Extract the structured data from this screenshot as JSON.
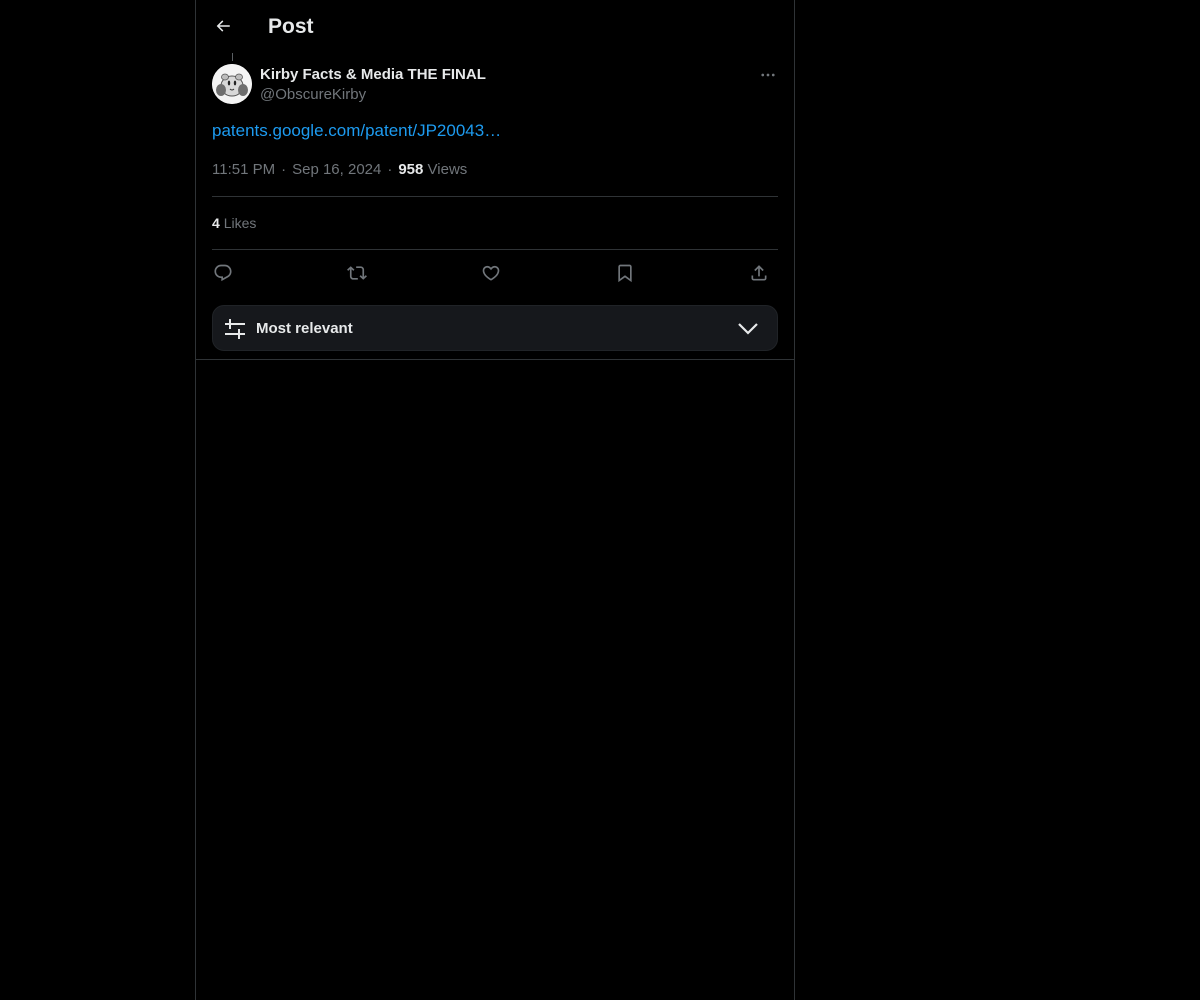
{
  "header": {
    "title": "Post"
  },
  "post": {
    "author": {
      "display_name": "Kirby Facts & Media THE FINAL",
      "handle": "@ObscureKirby"
    },
    "link_text": "patents.google.com/patent/JP20043…",
    "time": "11:51 PM",
    "separator": "·",
    "date": "Sep 16, 2024",
    "views_count": "958",
    "views_label": "Views",
    "likes_count": "4",
    "likes_label": "Likes"
  },
  "actions": [
    "reply-icon",
    "repost-icon",
    "like-icon",
    "bookmark-icon",
    "share-icon"
  ],
  "sort": {
    "label": "Most relevant"
  },
  "colors": {
    "background": "#000000",
    "text": "#e7e9ea",
    "secondary_text": "#71767b",
    "link": "#1d9bf0",
    "border": "#2f3336",
    "sort_bar": "#16181c"
  }
}
